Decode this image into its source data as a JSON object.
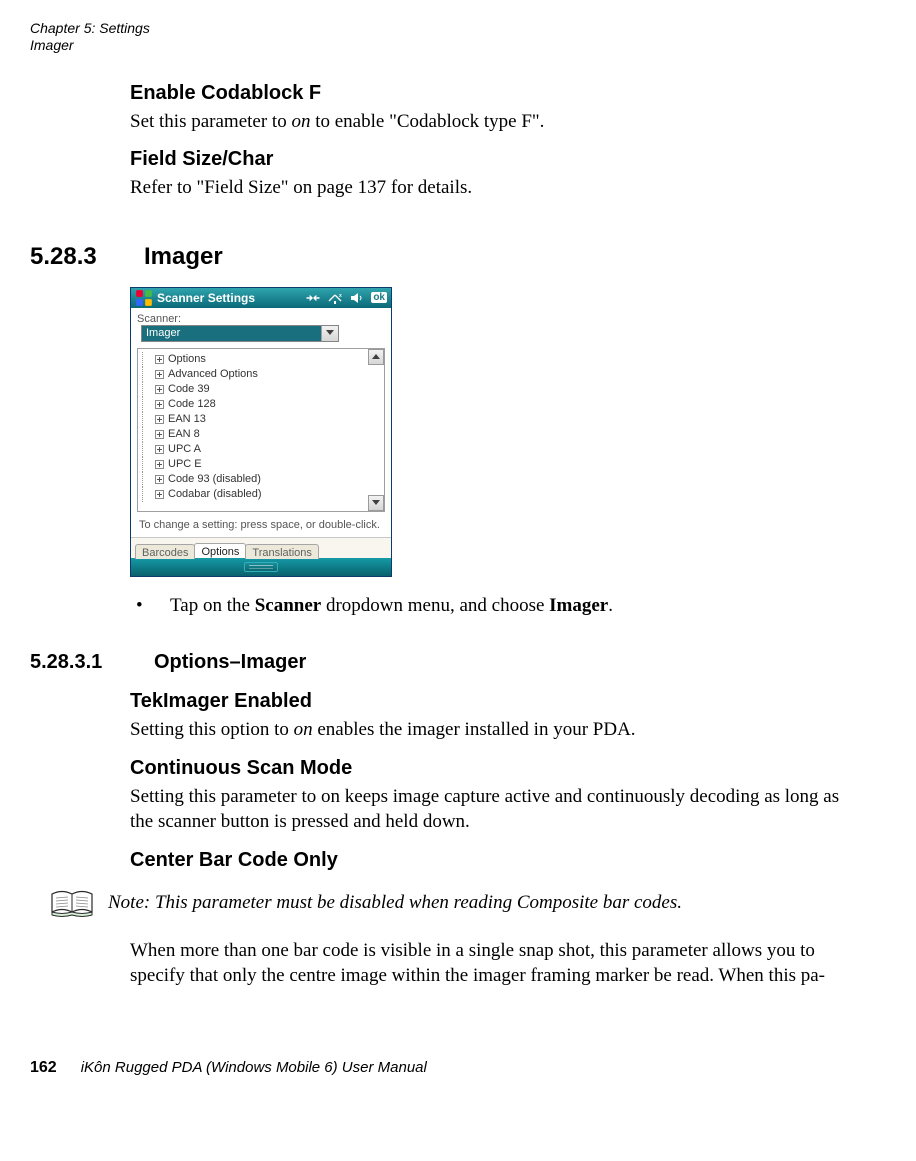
{
  "header": {
    "chapter": "Chapter 5:  Settings",
    "section": "Imager"
  },
  "content": {
    "enable_heading": "Enable Codablock F",
    "enable_para_pre": "Set this parameter to ",
    "enable_para_em": "on",
    "enable_para_post": " to enable \"Codablock type F\".",
    "field_heading": "Field Size/Char",
    "field_para": "Refer to \"Field Size\" on page 137 for details.",
    "h2_num": "5.28.3",
    "h2_title": "Imager",
    "bullet_pre": "Tap on the ",
    "bullet_b1": "Scanner",
    "bullet_mid": " dropdown menu, and choose ",
    "bullet_b2": "Imager",
    "bullet_post": ".",
    "h3_num": "5.28.3.1",
    "h3_title": "Options–Imager",
    "tek_heading": "TekImager Enabled",
    "tek_para_pre": "Setting this option to ",
    "tek_para_em": "on",
    "tek_para_post": " enables the imager installed in your PDA.",
    "cont_heading": "Continuous Scan Mode",
    "cont_para": "Setting this parameter to on keeps image capture active and continuously decoding as long as the scanner button is pressed and held down.",
    "center_heading": "Center Bar Code Only",
    "note_text": "Note: This parameter must be disabled when reading Composite bar codes.",
    "center_para": "When more than one bar code is visible in a single snap shot, this parameter allows you to specify that only the centre image within the imager framing marker be read. When this pa-"
  },
  "screenshot": {
    "titlebar_text": "Scanner Settings",
    "ok_text": "ok",
    "label_scanner": "Scanner:",
    "dropdown_value": "Imager",
    "tree_items": [
      "Options",
      "Advanced Options",
      "Code 39",
      "Code 128",
      "EAN 13",
      "EAN 8",
      "UPC A",
      "UPC E",
      "Code 93 (disabled)",
      "Codabar (disabled)"
    ],
    "hint": "To change a setting: press space, or double-click.",
    "tabs": [
      "Barcodes",
      "Options",
      "Translations"
    ],
    "active_tab_index": 1
  },
  "footer": {
    "page": "162",
    "title": "iKôn Rugged PDA (Windows Mobile 6) User Manual"
  }
}
